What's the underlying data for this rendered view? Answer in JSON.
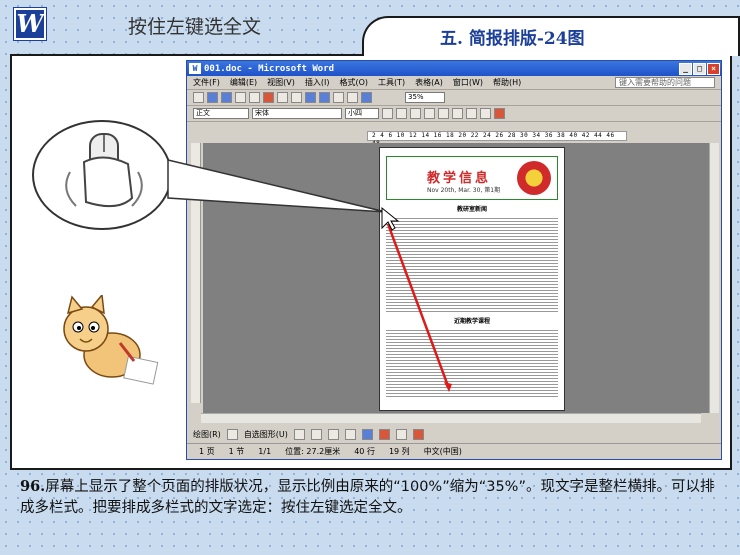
{
  "header": {
    "logo_letter": "W",
    "instruction": "按住左键选全文",
    "section_title": "五. 简报排版-24图"
  },
  "word": {
    "title": "001.doc - Microsoft Word",
    "menu": [
      "文件(F)",
      "编辑(E)",
      "视图(V)",
      "插入(I)",
      "格式(O)",
      "工具(T)",
      "表格(A)",
      "窗口(W)",
      "帮助(H)"
    ],
    "help_placeholder": "键入需要帮助的问题",
    "style_value": "正文",
    "font_value": "宋体",
    "size_value": "小四",
    "zoom_value": "35%",
    "ruler_text": "2 4 6 10 12 14 16 18 20 22 24 26 28 30 34 36 38 40 42 44 46 48",
    "newsletter_title": "教学信息",
    "newsletter_date": "Nov 20th, Mar. 30, 第1期",
    "section1_heading": "教研室新闻",
    "section2_heading": "近期教学课程",
    "draw_label": "绘图(R)",
    "autoshape_label": "自选图形(U)",
    "status": {
      "page": "1 页",
      "section": "1 节",
      "page_of": "1/1",
      "position": "位置: 27.2厘米",
      "line": "40 行",
      "column": "19 列",
      "language": "中文(中国)"
    }
  },
  "caption": {
    "number": "96.",
    "text": "屏幕上显示了整个页面的排版状况，显示比例由原来的“100%”缩为“35%”。现文字是整栏横排。可以排成多栏式。把要排成多栏式的文字选定：按住左键选定全文。"
  }
}
